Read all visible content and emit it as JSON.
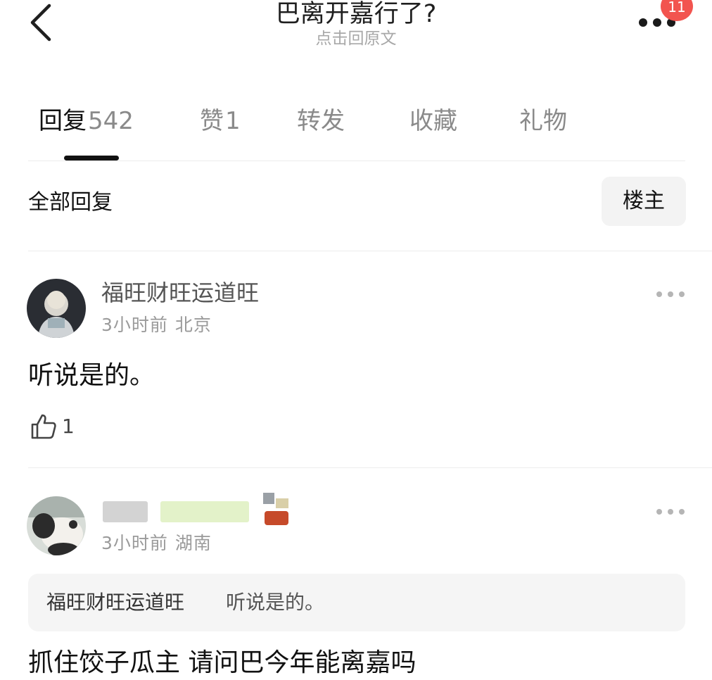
{
  "header": {
    "title": "巴离开嘉行了?",
    "subtitle": "点击回原文",
    "badge_count": "11",
    "back_icon": "chevron-left-icon",
    "more_icon": "more-dots-icon"
  },
  "tabs": [
    {
      "label": "回复",
      "count": "542",
      "active": true
    },
    {
      "label": "赞",
      "count": "1",
      "active": false
    },
    {
      "label": "转发",
      "count": "",
      "active": false
    },
    {
      "label": "收藏",
      "count": "",
      "active": false
    },
    {
      "label": "礼物",
      "count": "",
      "active": false
    }
  ],
  "filter": {
    "all_label": "全部回复",
    "owner_label": "楼主"
  },
  "comments": [
    {
      "username": "福旺财旺运道旺",
      "time": "3小时前",
      "location": "北京",
      "text": "听说是的。",
      "likes": "1"
    },
    {
      "username": "",
      "time": "3小时前",
      "location": "湖南",
      "quote_author": "福旺财旺运道旺",
      "quote_text": "听说是的。",
      "text": "抓住饺子瓜主 请问巴今年能离嘉吗"
    }
  ],
  "colors": {
    "badge": "#f2544f",
    "text_primary": "#111111",
    "text_secondary": "#9a9a9a",
    "divider": "#ececec"
  }
}
